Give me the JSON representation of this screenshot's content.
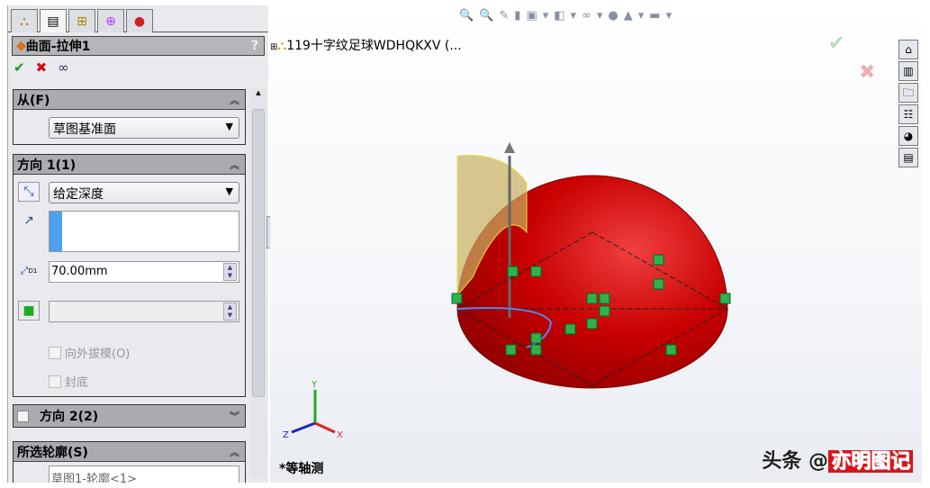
{
  "panel": {
    "tabs": [
      "feature-manager",
      "property-manager",
      "configuration-manager",
      "dim-xpert",
      "display-manager"
    ],
    "title": "曲面-拉伸1",
    "help": "?",
    "from": {
      "header": "从(F)",
      "value": "草图基准面"
    },
    "direction1": {
      "header": "方向 1(1)",
      "end_condition": "给定深度",
      "depth": "70.00mm",
      "depth_icon_label": "D1",
      "draft_outward": "向外拔模(O)",
      "cap_end": "封底"
    },
    "direction2": {
      "header": "方向 2(2)"
    },
    "contours": {
      "header": "所选轮廓(S)",
      "value": "草图1-轮廓<1>"
    }
  },
  "viewport": {
    "tree_label": "119十字纹足球WDHQKXV (...",
    "view_label": "*等轴测",
    "watermark": {
      "prefix": "头条 @",
      "stamp": "亦明图记"
    },
    "axes": {
      "x": "X",
      "y": "Y",
      "z": "Z"
    },
    "colors": {
      "body": "#c00000",
      "surface": "#d8c060",
      "relation": "#2fb24a"
    }
  }
}
